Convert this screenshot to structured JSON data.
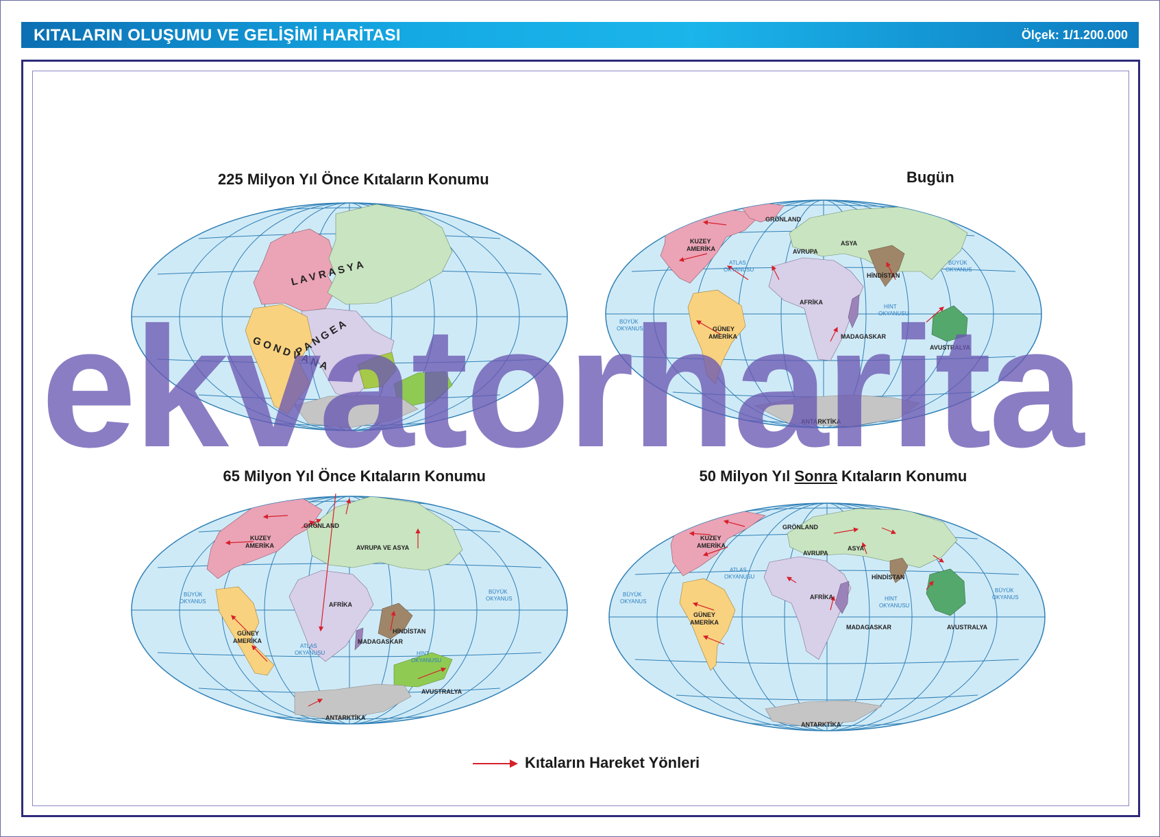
{
  "header": {
    "title": "KITALARIN OLUŞUMU VE GELİŞİMİ HARİTASI",
    "scale": "Ölçek: 1/1.200.000"
  },
  "colors": {
    "ocean": "#cfeaf7",
    "grid": "#2f7fb5",
    "north_america": "#eba3b6",
    "south_america": "#f9d27f",
    "africa": "#d8cfe8",
    "eurasia": "#c9e4c1",
    "india": "#a08669",
    "australia": "#55a86b",
    "antarctica": "#c5c5c5",
    "arrow": "#d6202a",
    "watermark": "#6a58b2"
  },
  "maps": {
    "m225": {
      "title": "225 Milyon Yıl Önce Kıtaların Konumu",
      "labels": {
        "lavrasya": "L A V R A S Y A",
        "pangea": "P A N G E A",
        "gondvana": "G O N D V A N A"
      }
    },
    "today": {
      "title": "Bugün",
      "labels": {
        "gronland": "GRÖNLAND",
        "kuzey1": "KUZEY",
        "kuzey2": "AMERİKA",
        "asya": "ASYA",
        "avrupa": "AVRUPA",
        "atlas1": "ATLAS",
        "atlas2": "OKYANUSU",
        "hindistan": "HİNDİSTAN",
        "buyuk_r1": "BÜYÜK",
        "buyuk_r2": "OKYANUS",
        "afrika": "AFRİKA",
        "hint1": "HİNT",
        "hint2": "OKYANUSU",
        "buyuk_l1": "BÜYÜK",
        "buyuk_l2": "OKYANUS",
        "guney1": "GÜNEY",
        "guney2": "AMERİKA",
        "madagaskar": "MADAGASKAR",
        "avustralya": "AVUSTRALYA",
        "antarktika": "ANTARKTİKA"
      }
    },
    "m65": {
      "title": "65 Milyon Yıl Önce Kıtaların Konumu",
      "labels": {
        "gronland": "GRÖNLAND",
        "kuzey1": "KUZEY",
        "kuzey2": "AMERİKA",
        "avrupa_asya": "AVRUPA VE ASYA",
        "buyuk_l1": "BÜYÜK",
        "buyuk_l2": "OKYANUS",
        "buyuk_r1": "BÜYÜK",
        "buyuk_r2": "OKYANUS",
        "afrika": "AFRİKA",
        "guney1": "GÜNEY",
        "guney2": "AMERİKA",
        "hindistan": "HİNDİSTAN",
        "madagaskar": "MADAGASKAR",
        "atlas1": "ATLAS",
        "atlas2": "OKYANUSU",
        "hint1": "HİNT",
        "hint2": "OKYANUSU",
        "avustralya": "AVUSTRALYA",
        "antarktika": "ANTARKTİKA"
      }
    },
    "future": {
      "title_pre": "50 Milyon Yıl ",
      "title_underlined": "Sonra",
      "title_post": " Kıtaların Konumu",
      "labels": {
        "gronland": "GRÖNLAND",
        "kuzey1": "KUZEY",
        "kuzey2": "AMERİKA",
        "asya": "ASYA",
        "avrupa": "AVRUPA",
        "atlas1": "ATLAS",
        "atlas2": "OKYANUSU",
        "hindistan": "HİNDİSTAN",
        "buyuk_l1": "BÜYÜK",
        "buyuk_l2": "OKYANUS",
        "buyuk_r1": "BÜYÜK",
        "buyuk_r2": "OKYANUS",
        "afrika": "AFRİKA",
        "hint1": "HİNT",
        "hint2": "OKYANUSU",
        "guney1": "GÜNEY",
        "guney2": "AMERİKA",
        "madagaskar": "MADAGASKAR",
        "avustralya": "AVUSTRALYA",
        "antarktika": "ANTARKTİKA"
      }
    }
  },
  "watermark": "ekvatorharita",
  "legend": {
    "label": "Kıtaların Hareket Yönleri"
  }
}
